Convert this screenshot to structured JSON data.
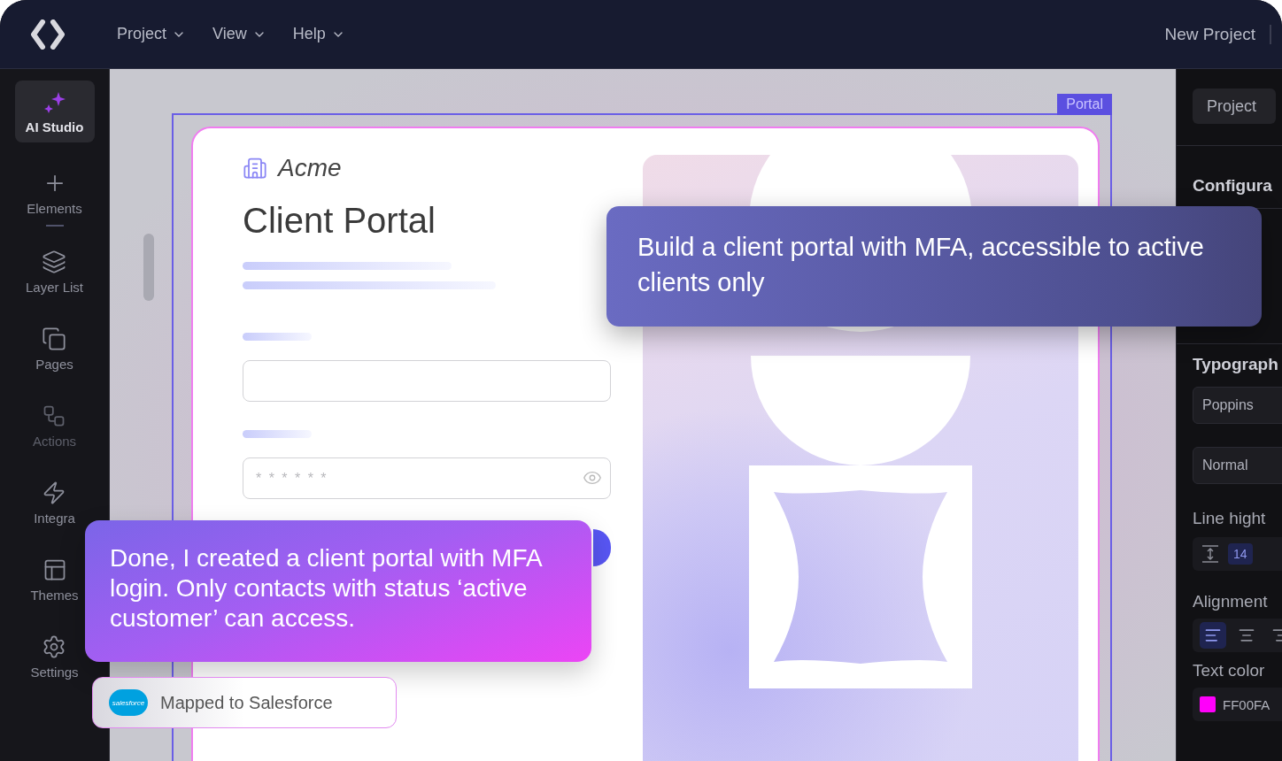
{
  "top_bar": {
    "menus": [
      {
        "label": "Project"
      },
      {
        "label": "View"
      },
      {
        "label": "Help"
      }
    ],
    "project_name": "New Project"
  },
  "sidebar": {
    "items": [
      {
        "kind": "ai",
        "label": "AI Studio",
        "selected": true,
        "disabled": false
      },
      {
        "kind": "elements",
        "label": "Elements",
        "selected": false,
        "disabled": false
      },
      {
        "kind": "layers",
        "label": "Layer List",
        "selected": false,
        "disabled": false
      },
      {
        "kind": "pages",
        "label": "Pages",
        "selected": false,
        "disabled": false
      },
      {
        "kind": "actions",
        "label": "Actions",
        "selected": false,
        "disabled": true
      },
      {
        "kind": "integrations",
        "label": "Integra",
        "selected": false,
        "disabled": false
      },
      {
        "kind": "themes",
        "label": "Themes",
        "selected": false,
        "disabled": false
      },
      {
        "kind": "settings",
        "label": "Settings",
        "selected": false,
        "disabled": false
      }
    ]
  },
  "canvas": {
    "frame_label": "Portal",
    "brand": "Acme",
    "title": "Client Portal",
    "password_placeholder": "* * * * * *"
  },
  "properties": {
    "project_button": "Project",
    "configuration_heading": "Configura",
    "typography_heading": "Typograph",
    "font_family": "Poppins",
    "font_weight": "Normal",
    "line_height_label": "Line hight",
    "line_height_value": "14",
    "alignment_label": "Alignment",
    "alignments": [
      {
        "kind": "left",
        "selected": true
      },
      {
        "kind": "center",
        "selected": false
      },
      {
        "kind": "right",
        "selected": false
      }
    ],
    "text_color_label": "Text color",
    "text_color": {
      "value": "FF00FA",
      "color": "#ff00fa"
    }
  },
  "prompt": "Build a client portal with MFA, accessible to active clients only",
  "reply": "Done, I created a client portal with MFA login. Only contacts with status ‘active customer’ can access.",
  "integration": {
    "logo_text": "salesforce",
    "label": "Mapped to Salesforce"
  }
}
